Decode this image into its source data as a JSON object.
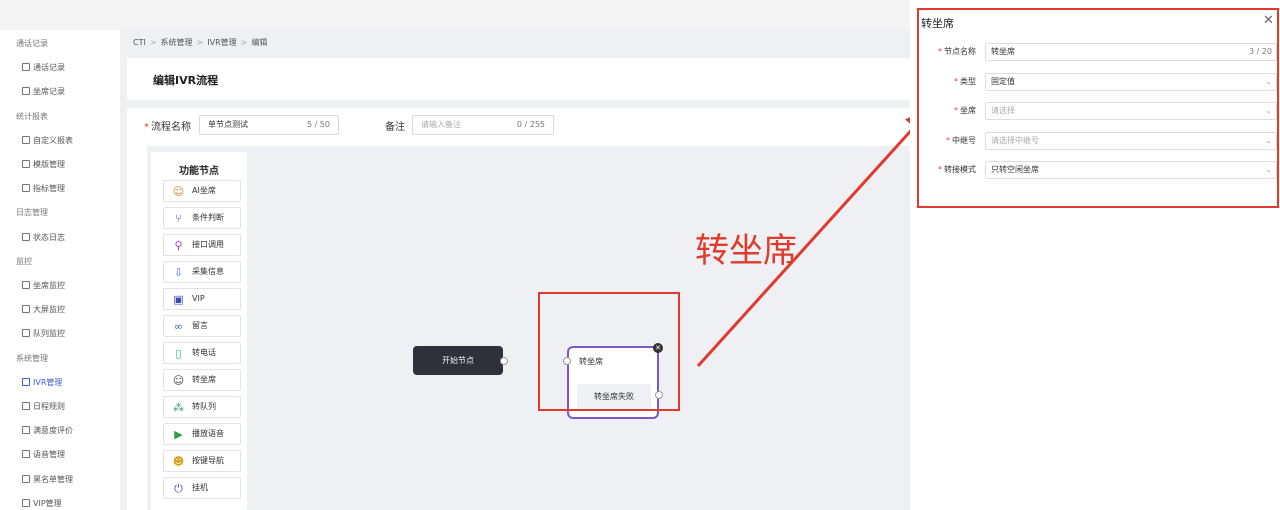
{
  "breadcrumb": {
    "items": [
      "CTI",
      "系统管理",
      "IVR管理",
      "编辑"
    ]
  },
  "page": {
    "title": "编辑IVR流程"
  },
  "sidebar": {
    "rows": [
      {
        "label": "通话记录",
        "type": "group"
      },
      {
        "label": "通话记录",
        "type": "item"
      },
      {
        "label": "坐席记录",
        "type": "item"
      },
      {
        "label": "统计报表",
        "type": "group"
      },
      {
        "label": "自定义报表",
        "type": "item"
      },
      {
        "label": "模版管理",
        "type": "item"
      },
      {
        "label": "指标管理",
        "type": "item"
      },
      {
        "label": "日志管理",
        "type": "group"
      },
      {
        "label": "状态日志",
        "type": "item"
      },
      {
        "label": "监控",
        "type": "group"
      },
      {
        "label": "坐席监控",
        "type": "item"
      },
      {
        "label": "大屏监控",
        "type": "item"
      },
      {
        "label": "队列监控",
        "type": "item"
      },
      {
        "label": "系统管理",
        "type": "group"
      },
      {
        "label": "IVR管理",
        "type": "item",
        "active": true
      },
      {
        "label": "日程规则",
        "type": "item"
      },
      {
        "label": "满意度评价",
        "type": "item"
      },
      {
        "label": "语音管理",
        "type": "item"
      },
      {
        "label": "黑名单管理",
        "type": "item"
      },
      {
        "label": "VIP管理",
        "type": "item"
      }
    ]
  },
  "form": {
    "flow_name_label": "流程名称",
    "flow_name_value": "单节点测试",
    "flow_name_count": "5 / 50",
    "remark_label": "备注",
    "remark_placeholder": "请输入备注",
    "remark_count": "0 / 255"
  },
  "palette": {
    "title": "功能节点",
    "nodes": [
      {
        "label": "AI坐席",
        "icon": "robot-icon",
        "glyph": "☺",
        "color": "#d9822b"
      },
      {
        "label": "条件判断",
        "icon": "branch-icon",
        "glyph": "⑂",
        "color": "#3d5cd8"
      },
      {
        "label": "接口调用",
        "icon": "plug-icon",
        "glyph": "⚲",
        "color": "#a13fc7"
      },
      {
        "label": "采集信息",
        "icon": "collect-icon",
        "glyph": "⇩",
        "color": "#4a6fd6"
      },
      {
        "label": "VIP",
        "icon": "vip-icon",
        "glyph": "▣",
        "color": "#3a4cb8"
      },
      {
        "label": "留言",
        "icon": "voicemail-icon",
        "glyph": "∞",
        "color": "#2f6fd6"
      },
      {
        "label": "转电话",
        "icon": "phone-icon",
        "glyph": "▯",
        "color": "#3aa66a"
      },
      {
        "label": "转坐席",
        "icon": "agent-icon",
        "glyph": "☺",
        "color": "#444444"
      },
      {
        "label": "转队列",
        "icon": "queue-icon",
        "glyph": "⁂",
        "color": "#2e9b6b"
      },
      {
        "label": "播放语音",
        "icon": "play-icon",
        "glyph": "▶",
        "color": "#2e9b4e"
      },
      {
        "label": "按键导航",
        "icon": "keypad-icon",
        "glyph": "☻",
        "color": "#d9a21b"
      },
      {
        "label": "挂机",
        "icon": "power-icon",
        "glyph": "⏻",
        "color": "#3a4cb8"
      }
    ]
  },
  "flow": {
    "start_label": "开始节点",
    "transfer_title": "转坐席",
    "transfer_branch": "转坐席失败"
  },
  "annotation": {
    "label": "转坐席"
  },
  "panel": {
    "title": "转坐席",
    "fields": [
      {
        "label": "节点名称",
        "value": "转坐席",
        "counter": "3 / 20",
        "placeholder": false,
        "select": false
      },
      {
        "label": "类型",
        "value": "固定值",
        "placeholder": false,
        "select": true
      },
      {
        "label": "坐席",
        "value": "请选择",
        "placeholder": true,
        "select": true
      },
      {
        "label": "中继号",
        "value": "请选择中继号",
        "placeholder": true,
        "select": true
      },
      {
        "label": "转接模式",
        "value": "只转空闲坐席",
        "placeholder": false,
        "select": true
      }
    ]
  },
  "colors": {
    "accent": "#3d5cd8",
    "annotation": "#e03a2c",
    "node_border": "#7c57c9"
  }
}
